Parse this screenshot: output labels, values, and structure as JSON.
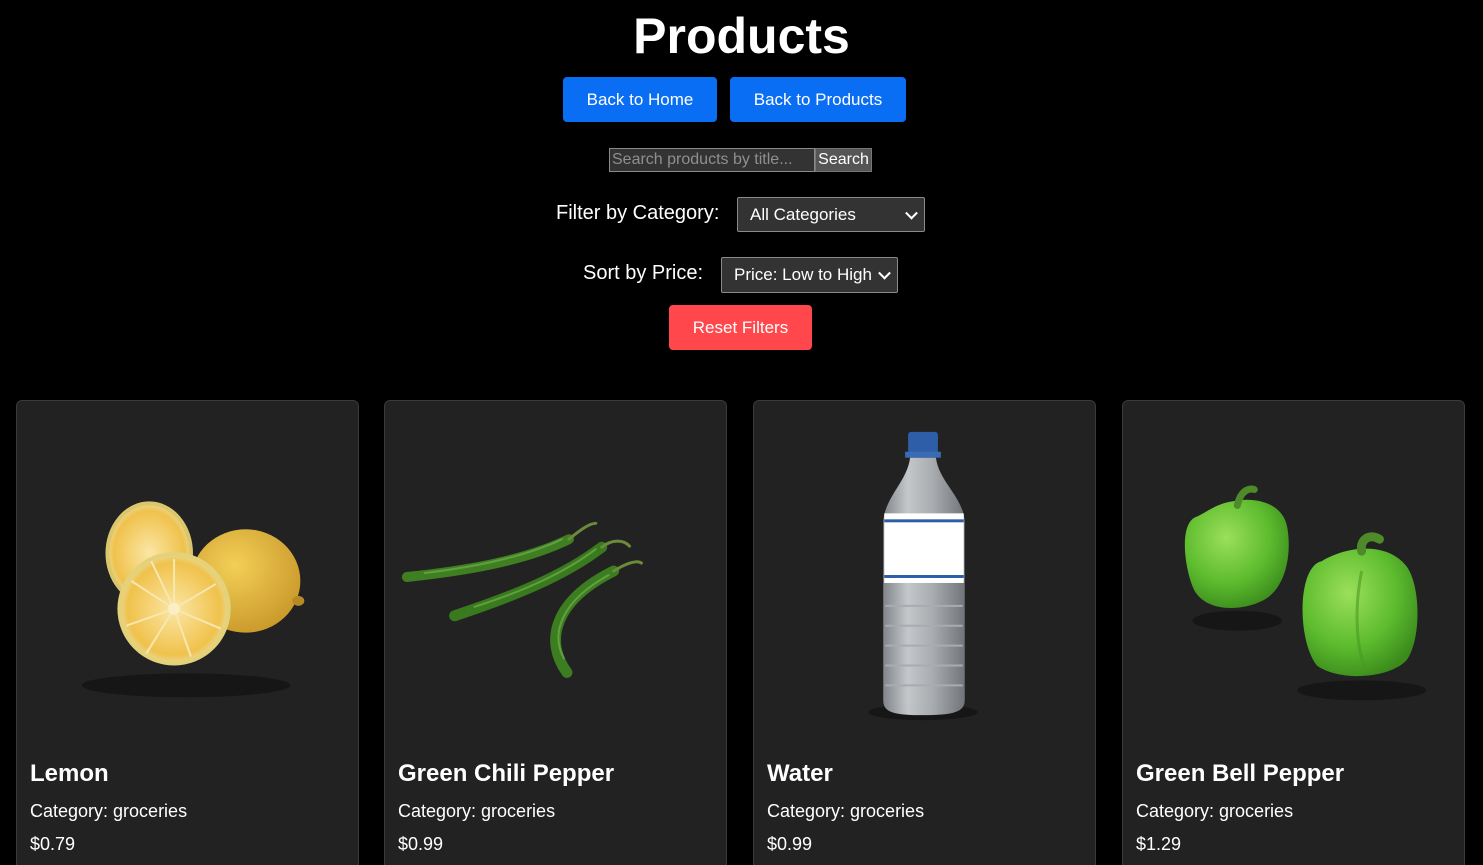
{
  "page": {
    "title": "Products"
  },
  "nav": {
    "home_label": "Back to Home",
    "products_label": "Back to Products"
  },
  "search": {
    "placeholder": "Search products by title...",
    "value": "",
    "button_label": "Search"
  },
  "filters": {
    "category_label": "Filter by Category:",
    "category_selected": "All Categories",
    "sort_label": "Sort by Price:",
    "sort_selected": "Price: Low to High",
    "reset_label": "Reset Filters"
  },
  "colors": {
    "primary_button": "#0a6ef5",
    "reset_button": "#ff474c",
    "background": "#000000",
    "card_background": "#222222"
  },
  "products": [
    {
      "name": "Lemon",
      "category": "Category: groceries",
      "price": "$0.79",
      "image_icon": "lemon-image"
    },
    {
      "name": "Green Chili Pepper",
      "category": "Category: groceries",
      "price": "$0.99",
      "image_icon": "chili-pepper-image"
    },
    {
      "name": "Water",
      "category": "Category: groceries",
      "price": "$0.99",
      "image_icon": "water-bottle-image"
    },
    {
      "name": "Green Bell Pepper",
      "category": "Category: groceries",
      "price": "$1.29",
      "image_icon": "bell-pepper-image"
    }
  ]
}
